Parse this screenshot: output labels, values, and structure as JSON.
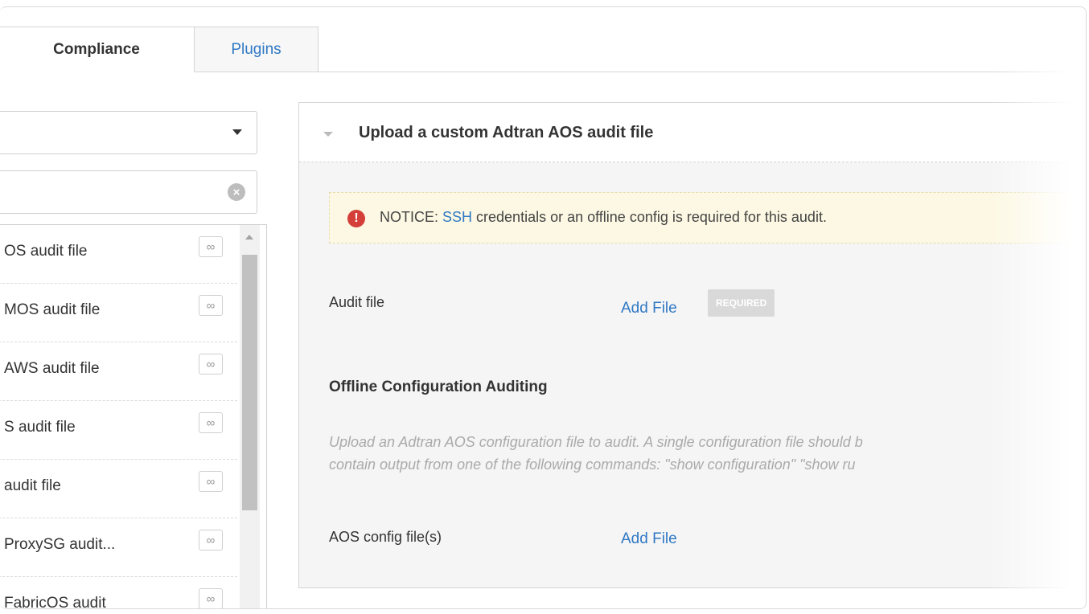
{
  "tabs": {
    "compliance": "Compliance",
    "plugins": "Plugins"
  },
  "list": {
    "items": [
      {
        "label": "OS audit file"
      },
      {
        "label": "MOS audit file"
      },
      {
        "label": "AWS audit file"
      },
      {
        "label": "S audit file"
      },
      {
        "label": "audit file"
      },
      {
        "label": "ProxySG audit..."
      },
      {
        "label": "FabricOS audit"
      }
    ],
    "link_icon": "∞"
  },
  "card": {
    "title": "Upload a custom Adtran AOS audit file",
    "notice": {
      "prefix": "NOTICE: ",
      "link": "SSH",
      "suffix": " credentials or an offline config is required for this audit."
    },
    "audit_file": {
      "label": "Audit file",
      "action": "Add File",
      "badge": "REQUIRED"
    },
    "offline": {
      "heading": "Offline Configuration Auditing",
      "desc_line1": "Upload an Adtran AOS configuration file to audit. A single configuration file should b",
      "desc_line2": "contain output from one of the following commands: \"show configuration\" \"show ru"
    },
    "config_file": {
      "label": "AOS config file(s)",
      "action": "Add File"
    }
  },
  "colors": {
    "link": "#2f78c4",
    "notice_bg": "#fcf8e3",
    "notice_icon": "#d43f3a"
  }
}
